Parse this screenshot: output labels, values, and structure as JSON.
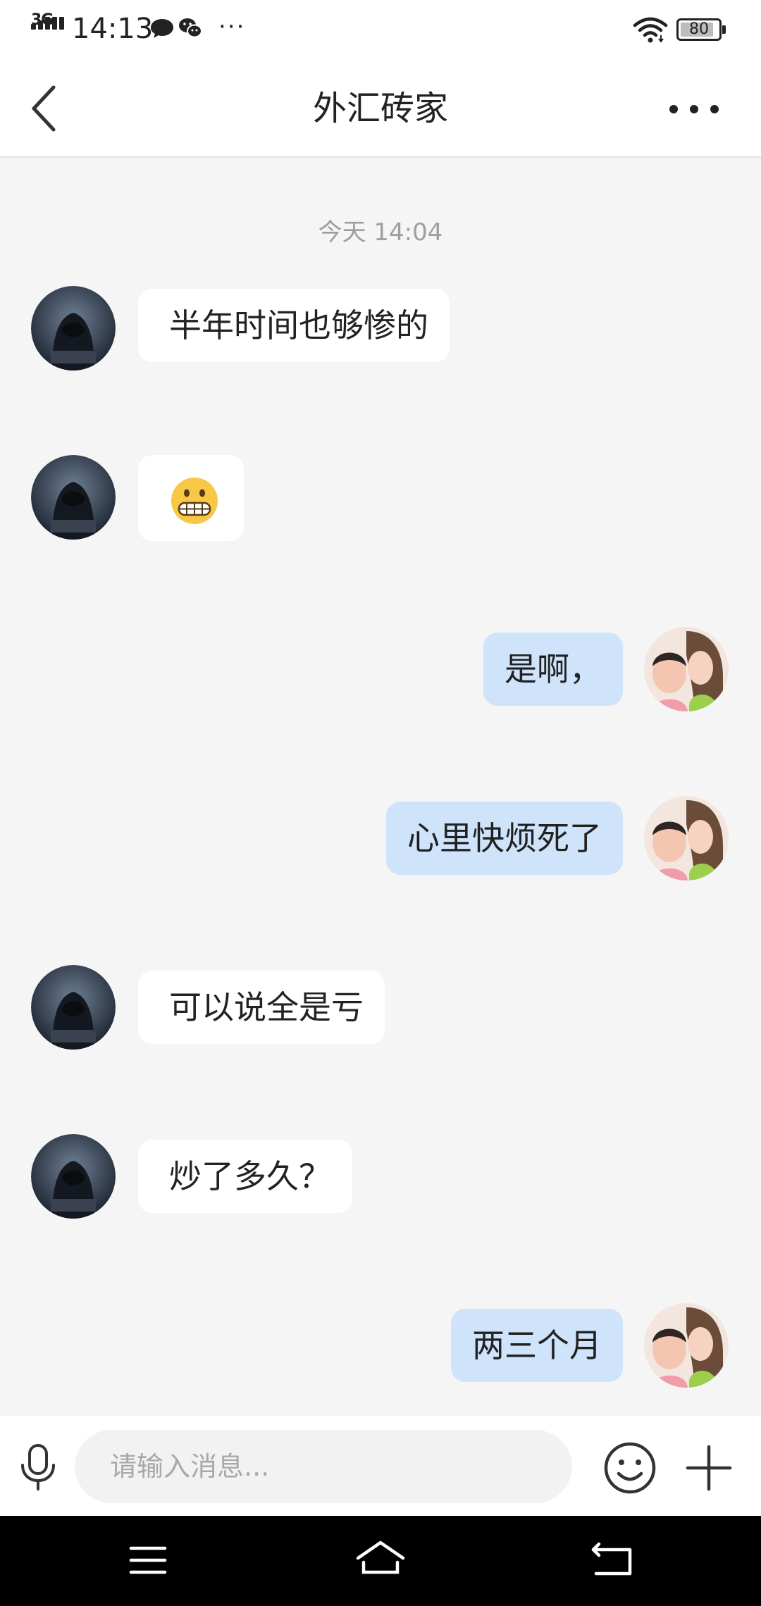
{
  "status_bar": {
    "network": "3G",
    "time": "14:13",
    "more": "···",
    "battery_level": "80"
  },
  "header": {
    "title": "外汇砖家",
    "back_icon": "chevron-left-icon",
    "more_icon": "more-horizontal-icon"
  },
  "chat": {
    "date_label": "今天 14:04",
    "messages": [
      {
        "side": "incoming",
        "text": "半年时间也够惨的"
      },
      {
        "side": "incoming",
        "emoji": "grimacing-face"
      },
      {
        "side": "outgoing",
        "text": "是啊，"
      },
      {
        "side": "outgoing",
        "text": "心里快烦死了"
      },
      {
        "side": "incoming",
        "text": "可以说全是亏"
      },
      {
        "side": "incoming",
        "text": "炒了多久？"
      },
      {
        "side": "outgoing",
        "text": "两三个月"
      }
    ]
  },
  "input_bar": {
    "placeholder": "请输入消息...",
    "value": ""
  },
  "colors": {
    "background": "#f5f5f5",
    "outgoing_bubble": "#cfe4fb",
    "incoming_bubble": "#ffffff",
    "system_nav": "#000000"
  }
}
